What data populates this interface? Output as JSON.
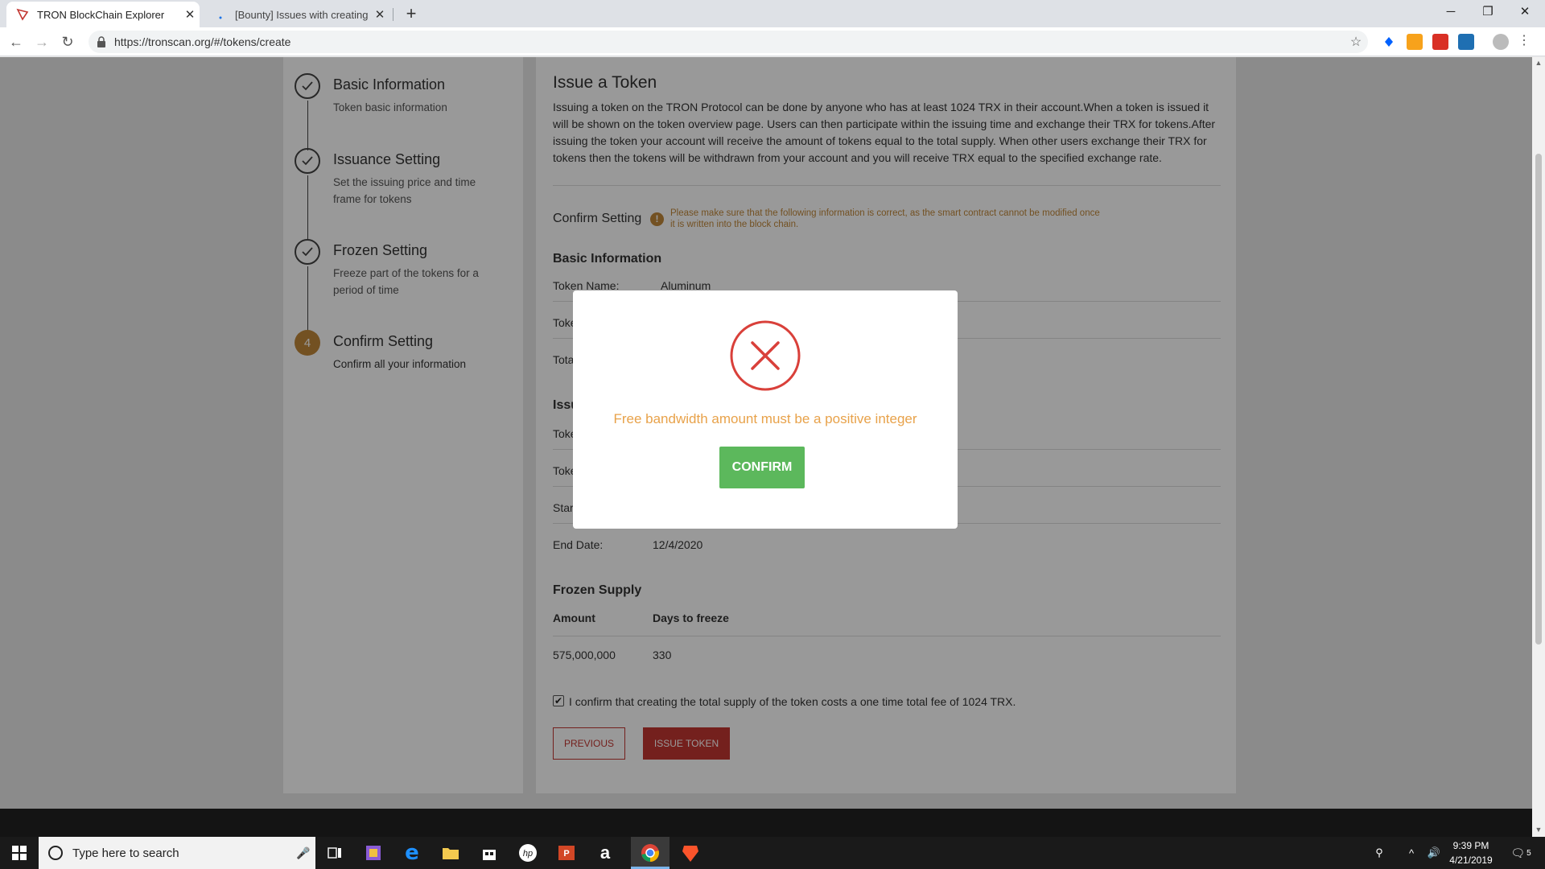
{
  "browser": {
    "tabs": [
      {
        "title": "TRON BlockChain Explorer",
        "active": true
      },
      {
        "title": "[Bounty] Issues with creating Tron",
        "active": false
      }
    ],
    "url": "https://tronscan.org/#/tokens/create"
  },
  "steps": [
    {
      "name": "Basic Information",
      "desc": "Token basic information",
      "state": "done"
    },
    {
      "name": "Issuance Setting",
      "desc": "Set the issuing price and time frame for tokens",
      "state": "done"
    },
    {
      "name": "Frozen Setting",
      "desc": "Freeze part of the tokens for a period of time",
      "state": "done"
    },
    {
      "name": "Confirm Setting",
      "desc": "Confirm all your information",
      "state": "current",
      "number": "4"
    }
  ],
  "main": {
    "title": "Issue a Token",
    "intro": "Issuing a token on the TRON Protocol can be done by anyone who has at least 1024 TRX in their account.When a token is issued it will be shown on the token overview page. Users can then participate within the issuing time and exchange their TRX for tokens.After issuing the token your account will receive the amount of tokens equal to the total supply. When other users exchange their TRX for tokens then the tokens will be withdrawn from your account and you will receive TRX equal to the specified exchange rate.",
    "confirm_setting": "Confirm Setting",
    "warning": "Please make sure that the following information is correct, as the smart contract cannot be modified once it is written into the block chain.",
    "basic_info": {
      "heading": "Basic Information",
      "token_name_label": "Token Name:",
      "token_name_value": "Aluminum",
      "row2_label": "Toke",
      "row3_label": "Tota"
    },
    "issuance": {
      "heading": "Issu",
      "row1_label": "Toke",
      "row2_label": "Toke",
      "row3_label": "Star",
      "end_date_label": "End Date:",
      "end_date_value": "12/4/2020"
    },
    "frozen": {
      "heading": "Frozen Supply",
      "col_amount": "Amount",
      "col_days": "Days to freeze",
      "amount": "575,000,000",
      "days": "330"
    },
    "confirm_checkbox_label": "I confirm that creating the total supply of the token costs a one time total fee of 1024 TRX.",
    "checkbox_checked": true,
    "btn_previous": "PREVIOUS",
    "btn_issue": "ISSUE TOKEN"
  },
  "modal": {
    "icon": "error-x-icon",
    "message": "Free bandwidth amount must be a positive integer",
    "confirm_label": "CONFIRM"
  },
  "taskbar": {
    "search_placeholder": "Type here to search",
    "time": "9:39 PM",
    "date": "4/21/2019",
    "notification_count": "5"
  },
  "colors": {
    "accent_orange": "#c0873a",
    "brand_red": "#c23631",
    "confirm_green": "#5cb85c",
    "error_red": "#d9403a"
  }
}
